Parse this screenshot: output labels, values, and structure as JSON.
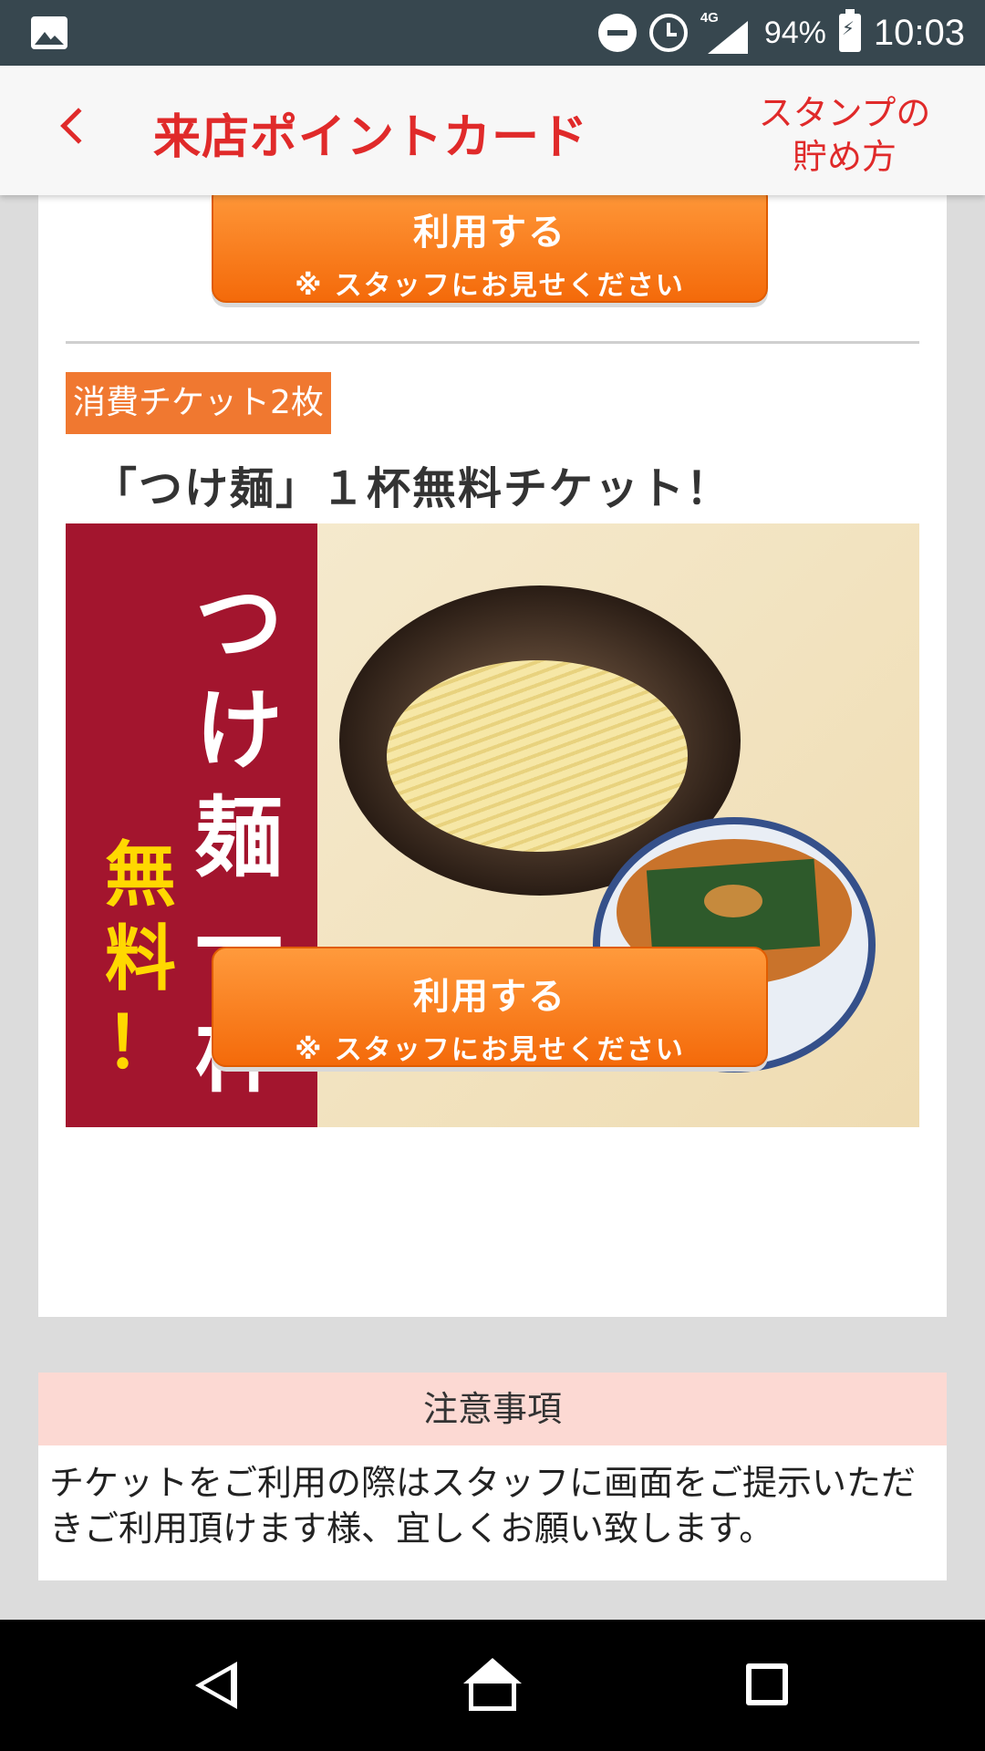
{
  "status_bar": {
    "network": "4G",
    "battery": "94%",
    "time": "10:03"
  },
  "header": {
    "title": "来店ポイントカード",
    "howto": "スタンプの\n貯め方"
  },
  "use_button": {
    "line1": "利用する",
    "line2": "※ スタッフにお見せください"
  },
  "ticket": {
    "badge": "消費チケット2枚",
    "title": "「つけ麺」１杯無料チケット！",
    "banner_lines": [
      "つ",
      "け",
      "麺",
      "一",
      "杯"
    ],
    "banner_free": [
      "無",
      "料",
      "！"
    ]
  },
  "notes": {
    "heading": "注意事項",
    "body": "チケットをご利用の際はスタッフに画面をご提示いただきご利用頂けます様、宜しくお願い致します。"
  },
  "colors": {
    "accent": "#e02a2a",
    "button": "#f46a0a",
    "badge": "#f07830",
    "notes_header": "#fcd9d3"
  }
}
